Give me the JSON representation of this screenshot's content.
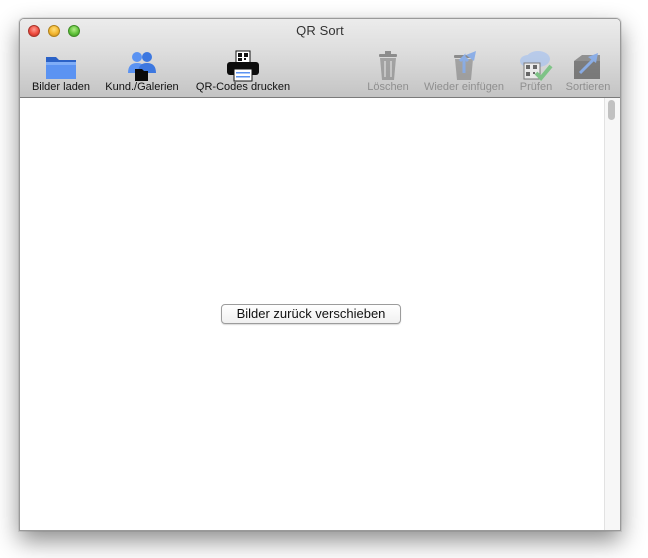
{
  "window": {
    "title": "QR Sort"
  },
  "toolbar": {
    "items": [
      {
        "label": "Bilder laden",
        "icon": "folder-icon",
        "enabled": true
      },
      {
        "label": "Kund./Galerien",
        "icon": "users-icon",
        "enabled": true
      },
      {
        "label": "QR-Codes drucken",
        "icon": "printer-qr-icon",
        "enabled": true
      },
      {
        "label": "Löschen",
        "icon": "trash-icon",
        "enabled": false
      },
      {
        "label": "Wieder einfügen",
        "icon": "restore-icon",
        "enabled": false
      },
      {
        "label": "Prüfen",
        "icon": "qr-check-icon",
        "enabled": false
      },
      {
        "label": "Sortieren",
        "icon": "sort-icon",
        "enabled": false
      }
    ]
  },
  "main": {
    "move_back_button": "Bilder zurück verschieben"
  },
  "colors": {
    "accent_blue": "#4d8bf0",
    "check_green": "#3cb84a"
  }
}
